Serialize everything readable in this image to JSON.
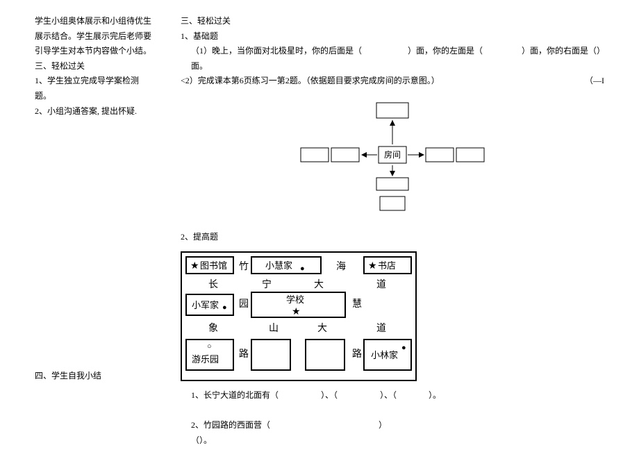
{
  "left": {
    "p1": "学生小组奥体展示和小组待优生展示结合。学生展示完后老师要引导学生对本节内容做个小结。",
    "s3_title": "三、轻松过关",
    "s3_item1": "1、学生独立完成导学案检测题。",
    "s3_item2": "2、小组沟通答案, 提出怀疑.",
    "s4_title": "四、学生自我小结"
  },
  "right": {
    "s3_title": "三、轻松过关",
    "q1_title": "1、基础题",
    "q1_text_a": "（1）晚上，当你面对北极星时，你的后面是（",
    "q1_text_b": "）面，你的左面是（",
    "q1_text_c": "）面，你的右面是（）面。",
    "q1_2_a": "<2）完成课本第6页练习一第2题。（依据题目要求完成房间的示意图。）",
    "q1_2_b": "（—I",
    "room_label": "房间",
    "q2_title": "2、提高题",
    "map": {
      "library": "图书馆",
      "xiaohui_home": "小慧家",
      "bookstore": "书店",
      "xiaojun_home": "小军家",
      "school": "学校",
      "amusement": "游乐园",
      "xiaolin_home": "小林家",
      "zhu": "竹",
      "hai": "海",
      "chang": "长",
      "ning": "宁",
      "da1": "大",
      "dao1": "道",
      "yuan": "园",
      "hui": "慧",
      "xiang": "象",
      "shan": "山",
      "da2": "大",
      "dao2": "道",
      "lu1": "路",
      "lu2": "路"
    },
    "q2_1_a": "1、长宁大道的北面有（",
    "q2_1_b": "）、（",
    "q2_1_c": "）、（",
    "q2_1_d": "）。",
    "q2_2_a": "2、竹园路的西面营（",
    "q2_2_b": "）",
    "bottom": "（）。"
  }
}
